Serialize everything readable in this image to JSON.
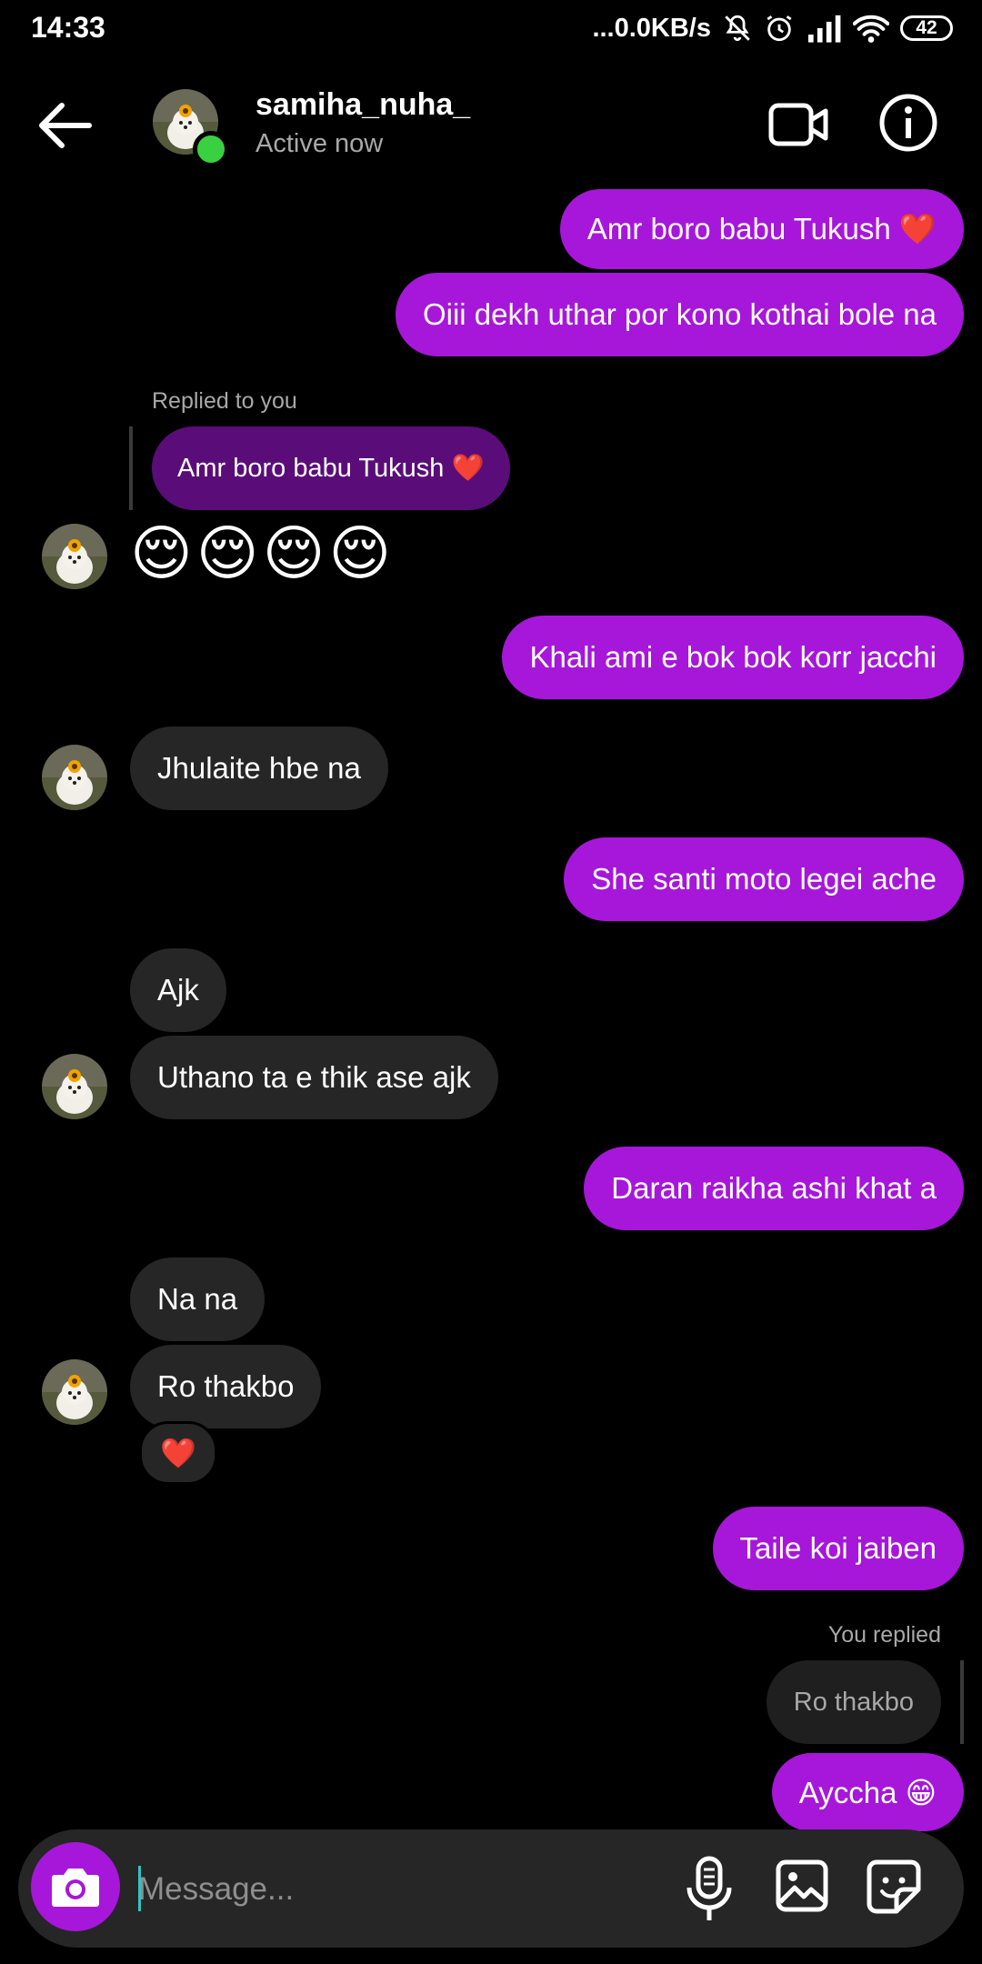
{
  "status_bar": {
    "time": "14:33",
    "network": "...0.0KB/s",
    "battery": "42"
  },
  "header": {
    "username": "samiha_nuha_",
    "presence": "Active now"
  },
  "messages": {
    "m1": "Amr boro babu Tukush ❤️",
    "m2": "Oiii dekh uthar por kono kothai bole na",
    "reply1_label": "Replied to you",
    "reply1_quote": "Amr boro babu Tukush ❤️",
    "m3": "😌😌😌😌",
    "m4": "Khali ami e bok bok korr jacchi",
    "m5": "Jhulaite hbe na",
    "m6": "She santi moto legei ache",
    "m7": "Ajk",
    "m8": "Uthano ta e thik ase ajk",
    "m9": "Daran raikha ashi khat a",
    "m10": "Na na",
    "m11": "Ro thakbo",
    "reaction": "❤️",
    "m12": "Taile koi jaiben",
    "reply2_label": "You replied",
    "reply2_quote": "Ro thakbo",
    "m13": "Ayccha 😁"
  },
  "composer": {
    "placeholder": "Message..."
  },
  "colors": {
    "outgoing_bubble": "#a617d9",
    "incoming_bubble": "#262626",
    "online": "#3ad141"
  },
  "icons": [
    "back-arrow-icon",
    "video-call-icon",
    "info-icon",
    "camera-icon",
    "microphone-icon",
    "gallery-icon",
    "sticker-icon"
  ]
}
